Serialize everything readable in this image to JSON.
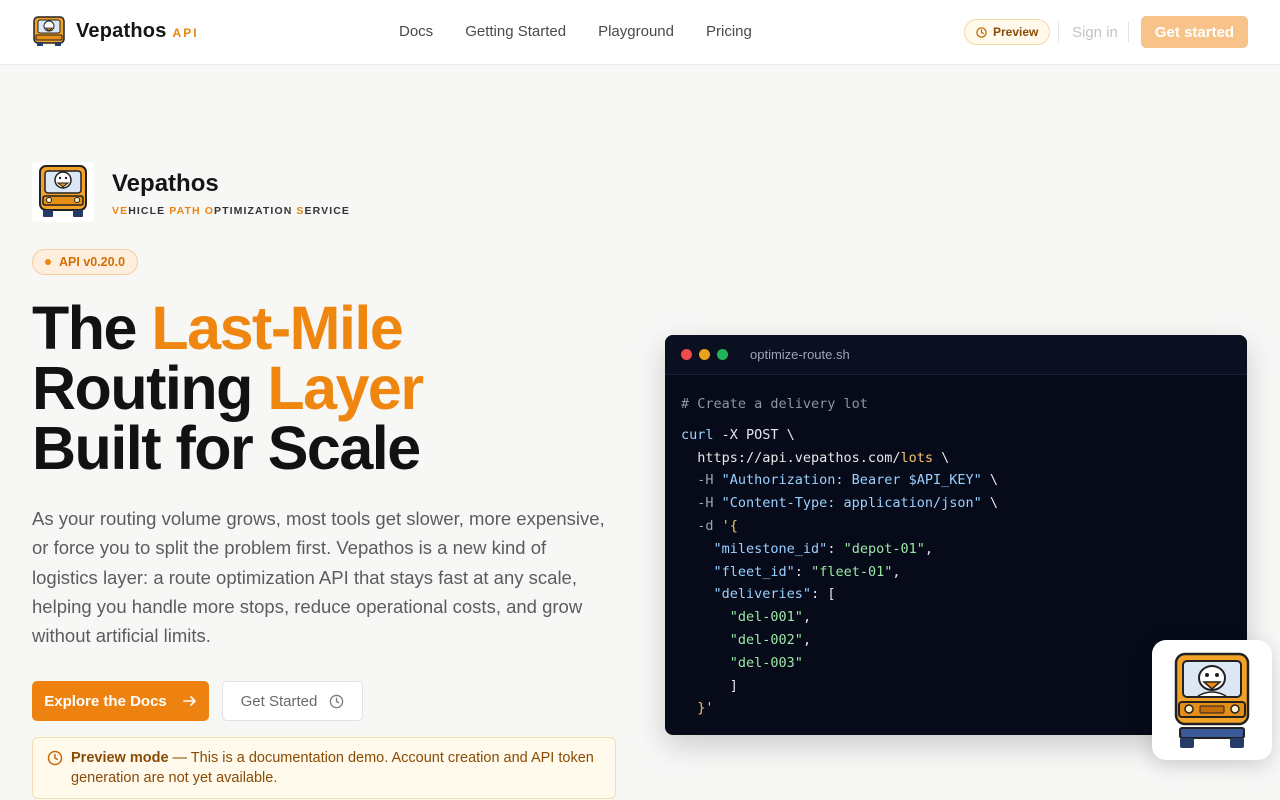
{
  "nav": {
    "brand_name": "Vepathos",
    "brand_tag": "API",
    "links": [
      "Docs",
      "Getting Started",
      "Playground",
      "Pricing"
    ],
    "preview_label": "Preview",
    "signin_label": "Sign in",
    "cta_label": "Get started"
  },
  "hero": {
    "name": "Vepathos",
    "subtitle_parts": [
      "VE",
      "HICLE ",
      "PATH",
      " ",
      "O",
      "PTIMIZATION ",
      "S",
      "ERVICE"
    ],
    "version": "API v0.20.0",
    "headline": {
      "line1_a": "The ",
      "line1_b": "Last-Mile",
      "line2_a": "Routing ",
      "line2_b": "Layer",
      "line3": "Built for Scale"
    },
    "lead": "As your routing volume grows, most tools get slower, more expensive, or force you to split the problem first. Vepathos is a new kind of logistics layer: a route optimization API that stays fast at any scale, helping you handle more stops, reduce operational costs, and grow without artificial limits.",
    "btn_docs": "Explore the Docs",
    "btn_started": "Get Started",
    "notice_bold": "Preview mode",
    "notice_text": " — This is a documentation demo. Account creation and API token generation are not yet available."
  },
  "code": {
    "filename": "optimize-route.sh",
    "comment": "# Create a delivery lot",
    "cmd": "curl",
    "method": " -X POST \\",
    "url_base": "  https://api.vepathos.com/",
    "url_path": "lots",
    "url_tail": " \\",
    "h1_flag": "  -H ",
    "h1_val": "\"Authorization: Bearer $API_KEY\"",
    "h2_flag": "  -H ",
    "h2_val": "\"Content-Type: application/json\"",
    "d_flag": "  -d ",
    "d_open": "'{",
    "k1": "\"milestone_id\"",
    "v1": "\"depot-01\"",
    "k2": "\"fleet_id\"",
    "v2": "\"fleet-01\"",
    "k3": "\"deliveries\"",
    "items": [
      "\"del-001\"",
      "\"del-002\"",
      "\"del-003\""
    ],
    "close_bracket": "      ]",
    "close_obj": "}'"
  },
  "colors": {
    "accent": "#ee8210",
    "accent_soft": "#f8c389",
    "code_bg": "#060a19",
    "dot_red": "#ed4a4a",
    "dot_yellow": "#e8a21b",
    "dot_green": "#22b45a"
  },
  "icons": {
    "logo": "duck-car-icon",
    "preview": "clock-icon",
    "docs_arrow": "arrow-right-icon",
    "started": "clock-icon",
    "notice": "clock-icon"
  }
}
